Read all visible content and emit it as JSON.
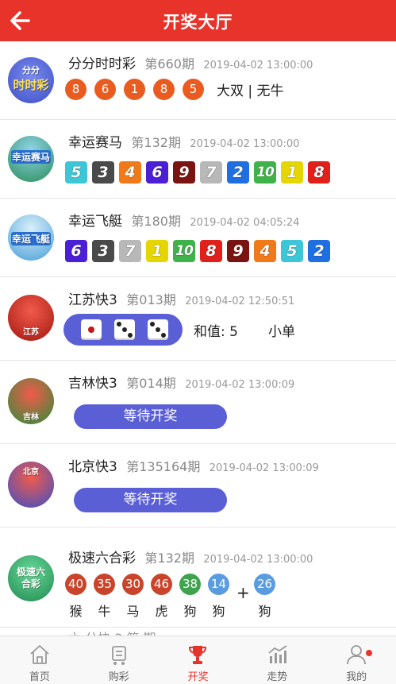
{
  "header": {
    "title": "开奖大厅"
  },
  "lotteries": [
    {
      "name": "分分时时彩",
      "issue": "第660期",
      "time": "2019-04-02 13:00:00",
      "logo_top": "分分",
      "logo_main": "时时彩",
      "balls": [
        "8",
        "6",
        "1",
        "8",
        "5"
      ],
      "summary": "大双 | 无牛"
    },
    {
      "name": "幸运赛马",
      "issue": "第132期",
      "time": "2019-04-02 13:00:00",
      "logo_main": "幸运赛马",
      "numbers": [
        "5",
        "3",
        "4",
        "6",
        "9",
        "7",
        "2",
        "10",
        "1",
        "8"
      ]
    },
    {
      "name": "幸运飞艇",
      "issue": "第180期",
      "time": "2019-04-02 04:05:24",
      "logo_main": "幸运飞艇",
      "numbers": [
        "6",
        "3",
        "7",
        "1",
        "10",
        "8",
        "9",
        "4",
        "5",
        "2"
      ]
    },
    {
      "name": "江苏快3",
      "issue": "第013期",
      "time": "2019-04-02 12:50:51",
      "logo_main": "江苏",
      "dice": [
        1,
        3,
        3
      ],
      "sum_label": "和值: 5",
      "size_label": "小单"
    },
    {
      "name": "吉林快3",
      "issue": "第014期",
      "time": "2019-04-02 13:00:09",
      "logo_main": "吉林",
      "wait_label": "等待开奖"
    },
    {
      "name": "北京快3",
      "issue": "第135164期",
      "time": "2019-04-02 13:00:09",
      "logo_main": "北京",
      "wait_label": "等待开奖"
    },
    {
      "name": "极速六合彩",
      "issue": "第132期",
      "time": "2019-04-02 13:00:00",
      "logo_main": "极速六合彩",
      "balls": [
        {
          "num": "40",
          "zodiac": "猴",
          "color": "#c8452c"
        },
        {
          "num": "35",
          "zodiac": "牛",
          "color": "#c8452c"
        },
        {
          "num": "30",
          "zodiac": "马",
          "color": "#c8452c"
        },
        {
          "num": "46",
          "zodiac": "虎",
          "color": "#c8452c"
        },
        {
          "num": "38",
          "zodiac": "狗",
          "color": "#3fa34d"
        },
        {
          "num": "14",
          "zodiac": "狗",
          "color": "#5b9be0"
        }
      ],
      "plus": "+",
      "special": {
        "num": "26",
        "zodiac": "狗",
        "color": "#5b9be0"
      }
    }
  ],
  "peek_text": "六 分快 3  第 期",
  "pk_colors": {
    "1": "#e6d600",
    "2": "#1f6fe0",
    "3": "#4a4a4a",
    "4": "#f07a1a",
    "5": "#3cc7d8",
    "6": "#4a1fd6",
    "7": "#b8b8b8",
    "8": "#e0201b",
    "9": "#7a1410",
    "10": "#3fb34a"
  },
  "tabs": [
    {
      "label": "首页",
      "icon": "home-icon"
    },
    {
      "label": "购彩",
      "icon": "cart-icon"
    },
    {
      "label": "开奖",
      "icon": "trophy-icon",
      "active": true
    },
    {
      "label": "走势",
      "icon": "trend-chart-icon"
    },
    {
      "label": "我的",
      "icon": "user-icon",
      "badge": true
    }
  ]
}
